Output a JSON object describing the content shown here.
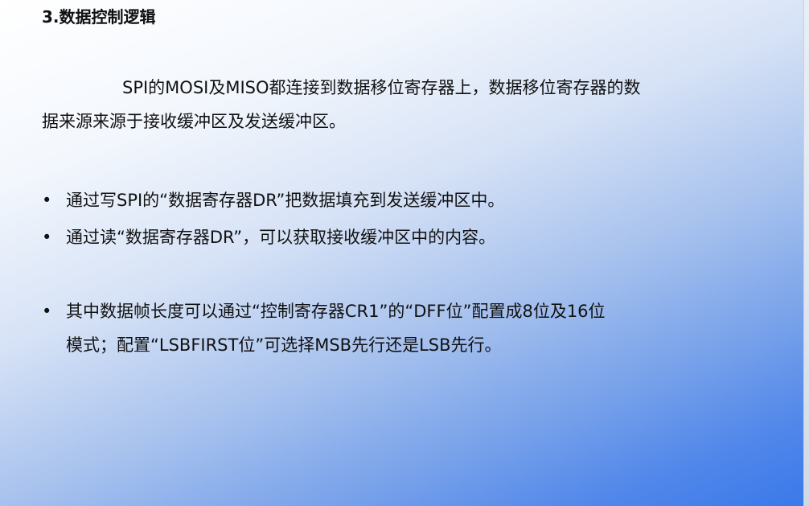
{
  "title": "3.数据控制逻辑",
  "paragraph": {
    "line1": "SPI的MOSI及MISO都连接到数据移位寄存器上，数据移位寄存器的数",
    "line2": "据来源来源于接收缓冲区及发送缓冲区。"
  },
  "bullets": [
    {
      "marker": "•",
      "lines": [
        "通过写SPI的“数据寄存器DR”把数据填充到发送缓冲区中。"
      ]
    },
    {
      "marker": "•",
      "lines": [
        "通过读“数据寄存器DR”，可以获取接收缓冲区中的内容。"
      ]
    },
    {
      "marker": "•",
      "lines": [
        "其中数据帧长度可以通过“控制寄存器CR1”的“DFF位”配置成8位及16位",
        "模式；配置“LSBFIRST位”可选择MSB先行还是LSB先行。"
      ]
    }
  ]
}
